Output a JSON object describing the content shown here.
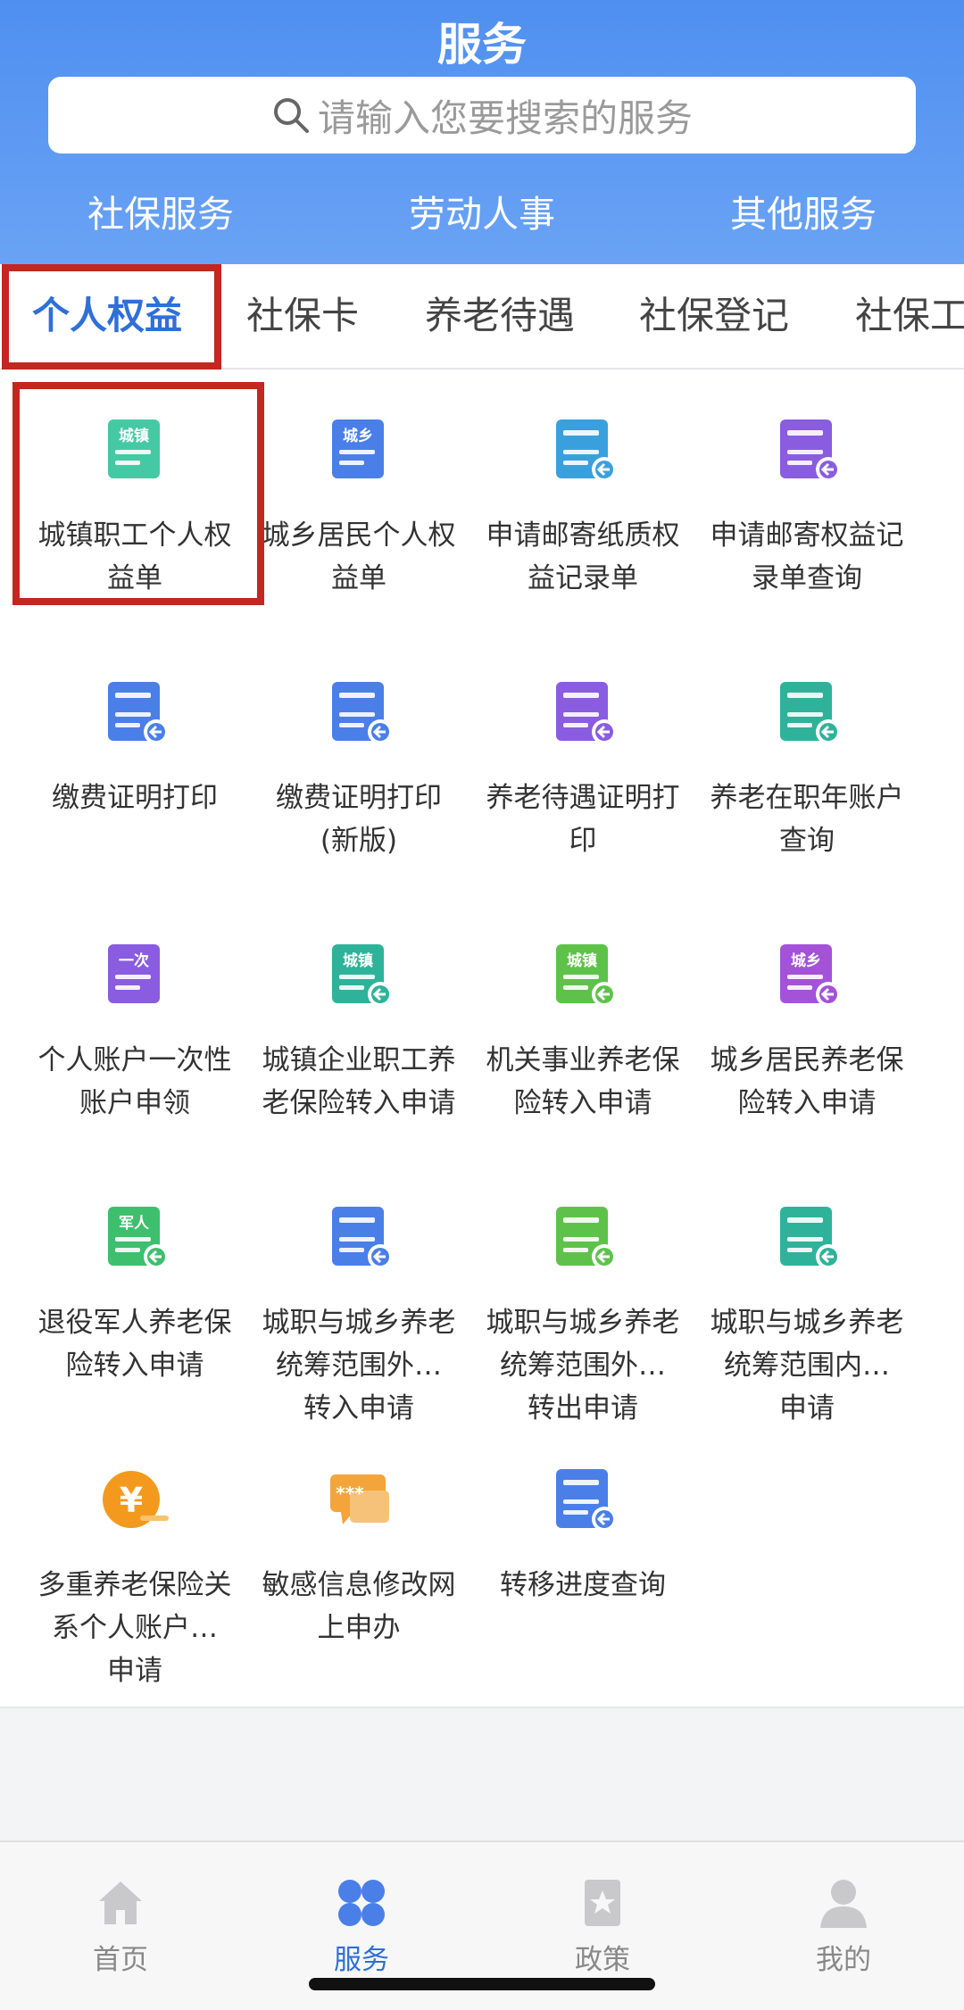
{
  "header": {
    "title": "服务",
    "search_placeholder": "请输入您要搜索的服务",
    "tabs": [
      {
        "label": "社保服务",
        "active": true
      },
      {
        "label": "劳动人事",
        "active": false
      },
      {
        "label": "其他服务",
        "active": false
      }
    ]
  },
  "sub_tabs": [
    {
      "label": "个人权益",
      "active": true
    },
    {
      "label": "社保卡",
      "active": false
    },
    {
      "label": "养老待遇",
      "active": false
    },
    {
      "label": "社保登记",
      "active": false
    },
    {
      "label": "社保工",
      "active": false
    }
  ],
  "services": [
    {
      "line1": "城镇职工个人权",
      "line2": "益单",
      "line3": "",
      "icon": "city-doc-icon",
      "icon_text": "城镇",
      "color": "#45c9a4"
    },
    {
      "line1": "城乡居民个人权",
      "line2": "益单",
      "line3": "",
      "icon": "rural-doc-icon",
      "icon_text": "城乡",
      "color": "#4a7fe8"
    },
    {
      "line1": "申请邮寄纸质权",
      "line2": "益记录单",
      "line3": "",
      "icon": "delivery-truck-icon",
      "icon_text": "",
      "color": "#3aa0dd"
    },
    {
      "line1": "申请邮寄权益记",
      "line2": "录单查询",
      "line3": "",
      "icon": "delivery-search-icon",
      "icon_text": "",
      "color": "#8a5ce0"
    },
    {
      "line1": "缴费证明打印",
      "line2": "",
      "line3": "",
      "icon": "payment-print-icon",
      "icon_text": "",
      "color": "#4a7fe8"
    },
    {
      "line1": "缴费证明打印",
      "line2": "(新版)",
      "line3": "",
      "icon": "payment-print-new-icon",
      "icon_text": "",
      "color": "#4a7fe8"
    },
    {
      "line1": "养老待遇证明打",
      "line2": "印",
      "line3": "",
      "icon": "pension-print-icon",
      "icon_text": "",
      "color": "#8a5ce0"
    },
    {
      "line1": "养老在职年账户",
      "line2": "查询",
      "line3": "",
      "icon": "pension-account-icon",
      "icon_text": "",
      "color": "#2eb39a"
    },
    {
      "line1": "个人账户一次性",
      "line2": "账户申领",
      "line3": "",
      "icon": "one-time-card-icon",
      "icon_text": "一次",
      "color": "#8a5ce0"
    },
    {
      "line1": "城镇企业职工养",
      "line2": "老保险转入申请",
      "line3": "",
      "icon": "city-transfer-icon",
      "icon_text": "城镇",
      "color": "#2eb39a"
    },
    {
      "line1": "机关事业养老保",
      "line2": "险转入申请",
      "line3": "",
      "icon": "institution-transfer-icon",
      "icon_text": "城镇",
      "color": "#5ec24a"
    },
    {
      "line1": "城乡居民养老保",
      "line2": "险转入申请",
      "line3": "",
      "icon": "rural-transfer-icon",
      "icon_text": "城乡",
      "color": "#a452d8"
    },
    {
      "line1": "退役军人养老保",
      "line2": "险转入申请",
      "line3": "",
      "icon": "veteran-transfer-icon",
      "icon_text": "军人",
      "color": "#3dbf6e"
    },
    {
      "line1": "城职与城乡养老",
      "line2": "统筹范围外…",
      "line3": "转入申请",
      "icon": "outside-transfer-in-icon",
      "icon_text": "",
      "color": "#4a7fe8"
    },
    {
      "line1": "城职与城乡养老",
      "line2": "统筹范围外…",
      "line3": "转出申请",
      "icon": "outside-transfer-out-icon",
      "icon_text": "",
      "color": "#5ec24a"
    },
    {
      "line1": "城职与城乡养老",
      "line2": "统筹范围内…",
      "line3": "申请",
      "icon": "inside-apply-icon",
      "icon_text": "",
      "color": "#2eb39a"
    },
    {
      "line1": "多重养老保险关",
      "line2": "系个人账户…",
      "line3": "申请",
      "icon": "yuan-coin-icon",
      "icon_text": "¥",
      "color": "#f39a1e"
    },
    {
      "line1": "敏感信息修改网",
      "line2": "上申办",
      "line3": "",
      "icon": "sensitive-info-icon",
      "icon_text": "***",
      "color": "#f3a43a"
    },
    {
      "line1": "转移进度查询",
      "line2": "",
      "line3": "",
      "icon": "transfer-progress-icon",
      "icon_text": "",
      "color": "#4a7fe8"
    }
  ],
  "bottom_nav": [
    {
      "label": "首页",
      "icon": "home-icon",
      "active": false
    },
    {
      "label": "服务",
      "icon": "service-icon",
      "active": true
    },
    {
      "label": "政策",
      "icon": "policy-icon",
      "active": false
    },
    {
      "label": "我的",
      "icon": "profile-icon",
      "active": false
    }
  ],
  "colors": {
    "header_blue": "#5b98f2",
    "active_blue": "#2f6fd8",
    "highlight_red": "#c3271f"
  }
}
